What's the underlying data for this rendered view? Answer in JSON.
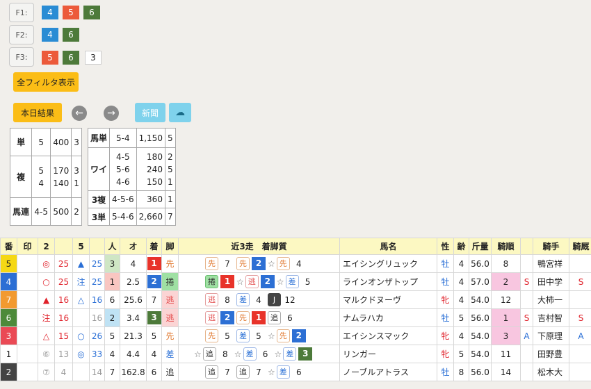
{
  "filters": [
    {
      "label": "F1:",
      "values": [
        {
          "v": "4",
          "c": "blue"
        },
        {
          "v": "5",
          "c": "red"
        },
        {
          "v": "6",
          "c": "green"
        }
      ]
    },
    {
      "label": "F2:",
      "values": [
        {
          "v": "4",
          "c": "blue"
        },
        {
          "v": "6",
          "c": "green"
        }
      ]
    },
    {
      "label": "F3:",
      "values": [
        {
          "v": "5",
          "c": "red"
        },
        {
          "v": "6",
          "c": "green"
        },
        {
          "v": "3",
          "c": "white"
        }
      ]
    }
  ],
  "buttons": {
    "show_all": "全フィルタ表示",
    "today_results": "本日結果",
    "prev": "←",
    "next": "→",
    "newspaper": "新聞",
    "cloud": "☁"
  },
  "payout_left": {
    "tan": {
      "label": "単",
      "horse": "5",
      "amount": "400",
      "pop": "3"
    },
    "fuku": {
      "label": "複",
      "horses": [
        "5",
        "4"
      ],
      "amounts": [
        "170",
        "140"
      ],
      "pops": [
        "3",
        "1"
      ]
    },
    "umaren": {
      "label": "馬連",
      "horse": "4-5",
      "amount": "500",
      "pop": "2"
    }
  },
  "payout_right": {
    "umatan": {
      "label": "馬単",
      "horse": "5-4",
      "amount": "1,150",
      "pop": "5"
    },
    "wide": {
      "label": "ワイ",
      "horses": [
        "4-5",
        "5-6",
        "4-6"
      ],
      "amounts": [
        "180",
        "240",
        "150"
      ],
      "pops": [
        "2",
        "5",
        "1"
      ]
    },
    "sanfuku": {
      "label": "3複",
      "horse": "4-5-6",
      "amount": "360",
      "pop": "1"
    },
    "santan": {
      "label": "3単",
      "horse": "5-4-6",
      "amount": "2,660",
      "pop": "7"
    }
  },
  "table": {
    "headers": [
      "番",
      "印",
      "2",
      "",
      "5",
      "",
      "人",
      "オ",
      "着",
      "脚",
      "近3走　着脚質",
      "馬名",
      "性",
      "齢",
      "斤量",
      "騎順",
      "",
      "騎手",
      "騎厩"
    ],
    "rows": [
      {
        "ban": "5",
        "banc": "#f5d814",
        "banfg": "#222",
        "m2": "◎",
        "m2c": "red",
        "n2": "25",
        "n2c": "red",
        "m5": "▲",
        "m5c": "blue",
        "n5": "25",
        "n5c": "blue",
        "ninki": "3",
        "ninkibg": "#cfe6c4",
        "odds": "4",
        "chaku": "1",
        "chakuc": "p1",
        "kyaku": "先",
        "kyakuc": "#e0762b",
        "kyakubg": "",
        "rec": [
          {
            "t": "box",
            "k": "lead",
            "v": "先"
          },
          {
            "t": "n",
            "v": "7"
          },
          {
            "t": "box",
            "k": "lead",
            "v": "先"
          },
          {
            "t": "pl",
            "c": "p2",
            "v": "2"
          },
          {
            "t": "star"
          },
          {
            "t": "box",
            "k": "lead",
            "v": "先"
          },
          {
            "t": "n",
            "v": "4"
          }
        ],
        "name": "エイシングリュック",
        "sex": "牡",
        "sexc": "blue",
        "age": "4",
        "kin": "56.0",
        "kijun": "8",
        "kijunbg": "",
        "s": "",
        "jockey": "鴨宮祥",
        "ky": ""
      },
      {
        "ban": "4",
        "banc": "#2c6fd4",
        "banfg": "#fff",
        "m2": "○",
        "m2c": "red",
        "n2": "25",
        "n2c": "red",
        "m5": "注",
        "m5c": "blue",
        "n5": "25",
        "n5c": "blue",
        "ninki": "1",
        "ninkibg": "#f9c6c1",
        "odds": "2.5",
        "chaku": "2",
        "chakuc": "p2",
        "kyaku": "捲",
        "kyakuc": "#333",
        "kyakubg": "#9fe0a3",
        "rec": [
          {
            "t": "box",
            "k": "mid",
            "v": "捲"
          },
          {
            "t": "pl",
            "c": "p1",
            "v": "1"
          },
          {
            "t": "star"
          },
          {
            "t": "box",
            "k": "escape",
            "v": "逃"
          },
          {
            "t": "pl",
            "c": "p2",
            "v": "2"
          },
          {
            "t": "star"
          },
          {
            "t": "box",
            "k": "stalk",
            "v": "差"
          },
          {
            "t": "n",
            "v": "5"
          }
        ],
        "name": "ラインオンザトップ",
        "sex": "牡",
        "sexc": "blue",
        "age": "4",
        "kin": "57.0",
        "kijun": "2",
        "kijunbg": "#f8c6e0",
        "s": "S",
        "jockey": "田中学",
        "ky": "S"
      },
      {
        "ban": "7",
        "banc": "#f29a30",
        "banfg": "#fff",
        "m2": "▲",
        "m2c": "red",
        "n2": "16",
        "n2c": "red",
        "m5": "△",
        "m5c": "blue",
        "n5": "16",
        "n5c": "blue",
        "ninki": "6",
        "ninkibg": "",
        "odds": "25.6",
        "chaku": "7",
        "chakuc": "",
        "kyaku": "逃",
        "kyakuc": "#e34a4a",
        "kyakubg": "#fbd4d4",
        "rec": [
          {
            "t": "box",
            "k": "escape",
            "v": "逃"
          },
          {
            "t": "n",
            "v": "8"
          },
          {
            "t": "box",
            "k": "stalk",
            "v": "差"
          },
          {
            "t": "n",
            "v": "4"
          },
          {
            "t": "box",
            "k": "J",
            "v": "J"
          },
          {
            "t": "n",
            "v": "12"
          }
        ],
        "name": "マルクドヌーヴ",
        "sex": "牝",
        "sexc": "red",
        "age": "4",
        "kin": "54.0",
        "kijun": "12",
        "kijunbg": "",
        "s": "",
        "jockey": "大柿一",
        "ky": ""
      },
      {
        "ban": "6",
        "banc": "#4d8a3a",
        "banfg": "#fff",
        "m2": "注",
        "m2c": "red",
        "n2": "16",
        "n2c": "red",
        "m5": "",
        "m5c": "blue",
        "n5": "16",
        "n5c": "gray",
        "ninki": "2",
        "ninkibg": "#bfe2f4",
        "odds": "3.4",
        "chaku": "3",
        "chakuc": "p3",
        "kyaku": "逃",
        "kyakuc": "#e34a4a",
        "kyakubg": "#fbd4d4",
        "rec": [
          {
            "t": "box",
            "k": "escape",
            "v": "逃"
          },
          {
            "t": "pl",
            "c": "p2",
            "v": "2"
          },
          {
            "t": "box",
            "k": "lead",
            "v": "先"
          },
          {
            "t": "pl",
            "c": "p1",
            "v": "1"
          },
          {
            "t": "box",
            "k": "close",
            "v": "追"
          },
          {
            "t": "n",
            "v": "6"
          }
        ],
        "name": "ナムラハカ",
        "sex": "牡",
        "sexc": "blue",
        "age": "5",
        "kin": "56.0",
        "kijun": "1",
        "kijunbg": "#f8c6e0",
        "s": "S",
        "jockey": "吉村智",
        "ky": "S"
      },
      {
        "ban": "3",
        "banc": "#ea4a55",
        "banfg": "#fff",
        "m2": "△",
        "m2c": "red",
        "n2": "15",
        "n2c": "red",
        "m5": "○",
        "m5c": "blue",
        "n5": "26",
        "n5c": "blue",
        "ninki": "5",
        "ninkibg": "",
        "odds": "21.3",
        "chaku": "5",
        "chakuc": "",
        "kyaku": "先",
        "kyakuc": "#e0762b",
        "kyakubg": "",
        "rec": [
          {
            "t": "box",
            "k": "lead",
            "v": "先"
          },
          {
            "t": "n",
            "v": "5"
          },
          {
            "t": "box",
            "k": "stalk",
            "v": "差"
          },
          {
            "t": "n",
            "v": "5"
          },
          {
            "t": "star"
          },
          {
            "t": "box",
            "k": "lead",
            "v": "先"
          },
          {
            "t": "pl",
            "c": "p2",
            "v": "2"
          }
        ],
        "name": "エイシンスマック",
        "sex": "牝",
        "sexc": "red",
        "age": "4",
        "kin": "54.0",
        "kijun": "3",
        "kijunbg": "#f8c6e0",
        "s": "A",
        "jockey": "下原理",
        "ky": "A"
      },
      {
        "ban": "1",
        "banc": "#ffffff",
        "banfg": "#222",
        "m2": "⑥",
        "m2c": "gray",
        "n2": "13",
        "n2c": "gray",
        "m5": "◎",
        "m5c": "blue",
        "n5": "33",
        "n5c": "blue",
        "ninki": "4",
        "ninkibg": "",
        "odds": "4.4",
        "chaku": "4",
        "chakuc": "",
        "kyaku": "差",
        "kyakuc": "#2a6fd6",
        "kyakubg": "",
        "rec": [
          {
            "t": "star"
          },
          {
            "t": "box",
            "k": "close",
            "v": "追"
          },
          {
            "t": "n",
            "v": "8"
          },
          {
            "t": "star"
          },
          {
            "t": "box",
            "k": "stalk",
            "v": "差"
          },
          {
            "t": "n",
            "v": "6"
          },
          {
            "t": "star"
          },
          {
            "t": "box",
            "k": "stalk",
            "v": "差"
          },
          {
            "t": "pl",
            "c": "p3",
            "v": "3"
          }
        ],
        "name": "リンガー",
        "sex": "牝",
        "sexc": "red",
        "age": "5",
        "kin": "54.0",
        "kijun": "11",
        "kijunbg": "",
        "s": "",
        "jockey": "田野豊",
        "ky": ""
      },
      {
        "ban": "2",
        "banc": "#444444",
        "banfg": "#fff",
        "m2": "⑦",
        "m2c": "gray",
        "n2": "4",
        "n2c": "gray",
        "m5": "",
        "m5c": "blue",
        "n5": "14",
        "n5c": "gray",
        "ninki": "7",
        "ninkibg": "",
        "odds": "162.8",
        "chaku": "6",
        "chakuc": "",
        "kyaku": "追",
        "kyakuc": "#333",
        "kyakubg": "",
        "rec": [
          {
            "t": "box",
            "k": "close",
            "v": "追"
          },
          {
            "t": "n",
            "v": "7"
          },
          {
            "t": "box",
            "k": "close",
            "v": "追"
          },
          {
            "t": "n",
            "v": "7"
          },
          {
            "t": "star"
          },
          {
            "t": "box",
            "k": "stalk",
            "v": "差"
          },
          {
            "t": "n",
            "v": "6"
          }
        ],
        "name": "ノーブルアトラス",
        "sex": "牡",
        "sexc": "blue",
        "age": "8",
        "kin": "56.0",
        "kijun": "14",
        "kijunbg": "",
        "s": "",
        "jockey": "松木大",
        "ky": ""
      }
    ]
  }
}
